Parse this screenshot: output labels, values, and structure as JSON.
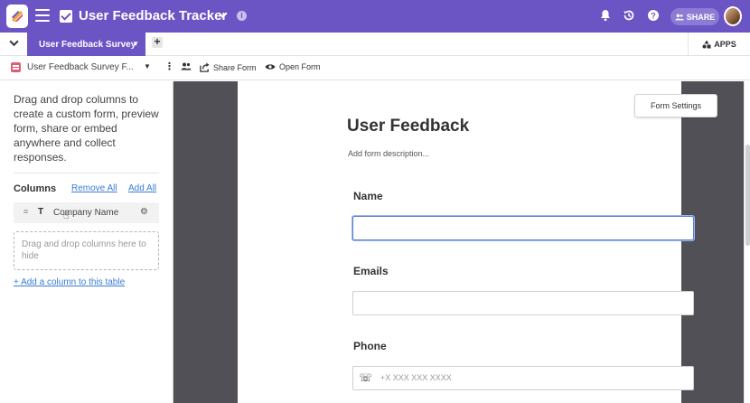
{
  "header": {
    "app_title": "User Feedback Tracker",
    "share_label": "SHARE"
  },
  "tabs": {
    "active_label": "User Feedback Survey",
    "apps_label": "APPS"
  },
  "toolbar": {
    "view_name": "User Feedback Survey F...",
    "share_form": "Share Form",
    "open_form": "Open Form"
  },
  "sidebar": {
    "instructions": "Drag and drop columns to create a custom form, preview form, share or embed anywhere and collect responses.",
    "columns_heading": "Columns",
    "remove_all": "Remove All",
    "add_all": "Add All",
    "column_items": [
      {
        "name": "Company Name",
        "type_icon": "T"
      }
    ],
    "drop_hint": "Drag and drop columns here to hide",
    "add_column": "+ Add a column to this table"
  },
  "form": {
    "settings_button": "Form Settings",
    "title": "User Feedback",
    "description_placeholder": "Add form description...",
    "fields": [
      {
        "label": "Name",
        "value": ""
      },
      {
        "label": "Emails",
        "value": ""
      },
      {
        "label": "Phone",
        "placeholder": "+X XXX XXX XXXX"
      }
    ]
  },
  "colors": {
    "brand": "#6b55c4",
    "link": "#3a7bd5",
    "focus": "#5a7fd8",
    "canvas_bg": "#505056"
  }
}
